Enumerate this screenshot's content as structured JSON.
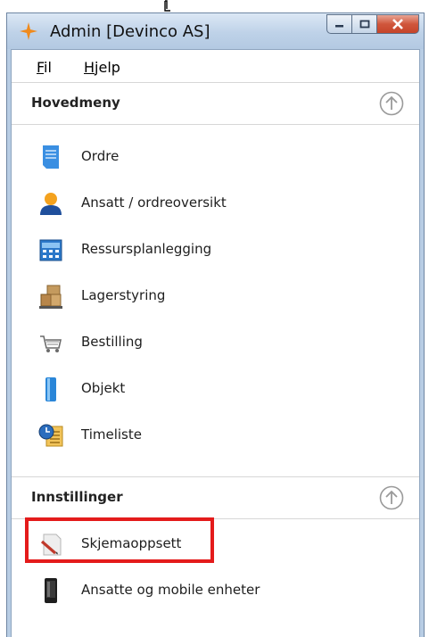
{
  "window": {
    "title": "Admin [Devinco AS]",
    "accent_colors": {
      "titlebar": "#b8cde4",
      "close_button": "#c5442a",
      "highlight": "#e41b1b"
    }
  },
  "menubar": [
    {
      "mnemonic": "F",
      "rest": "il"
    },
    {
      "mnemonic": "H",
      "rest": "jelp"
    }
  ],
  "sections": [
    {
      "title": "Hovedmeny",
      "items": [
        {
          "label": "Ordre",
          "icon": "document-icon"
        },
        {
          "label": "Ansatt / ordreoversikt",
          "icon": "person-icon"
        },
        {
          "label": "Ressursplanlegging",
          "icon": "calendar-icon"
        },
        {
          "label": "Lagerstyring",
          "icon": "warehouse-boxes-icon"
        },
        {
          "label": "Bestilling",
          "icon": "shopping-cart-icon"
        },
        {
          "label": "Objekt",
          "icon": "cylinder-icon"
        },
        {
          "label": "Timeliste",
          "icon": "clock-list-icon"
        }
      ]
    },
    {
      "title": "Innstillinger",
      "items": [
        {
          "label": "Skjemaoppsett",
          "icon": "form-pen-icon"
        },
        {
          "label": "Ansatte og mobile enheter",
          "icon": "mobile-phone-icon"
        }
      ]
    }
  ]
}
